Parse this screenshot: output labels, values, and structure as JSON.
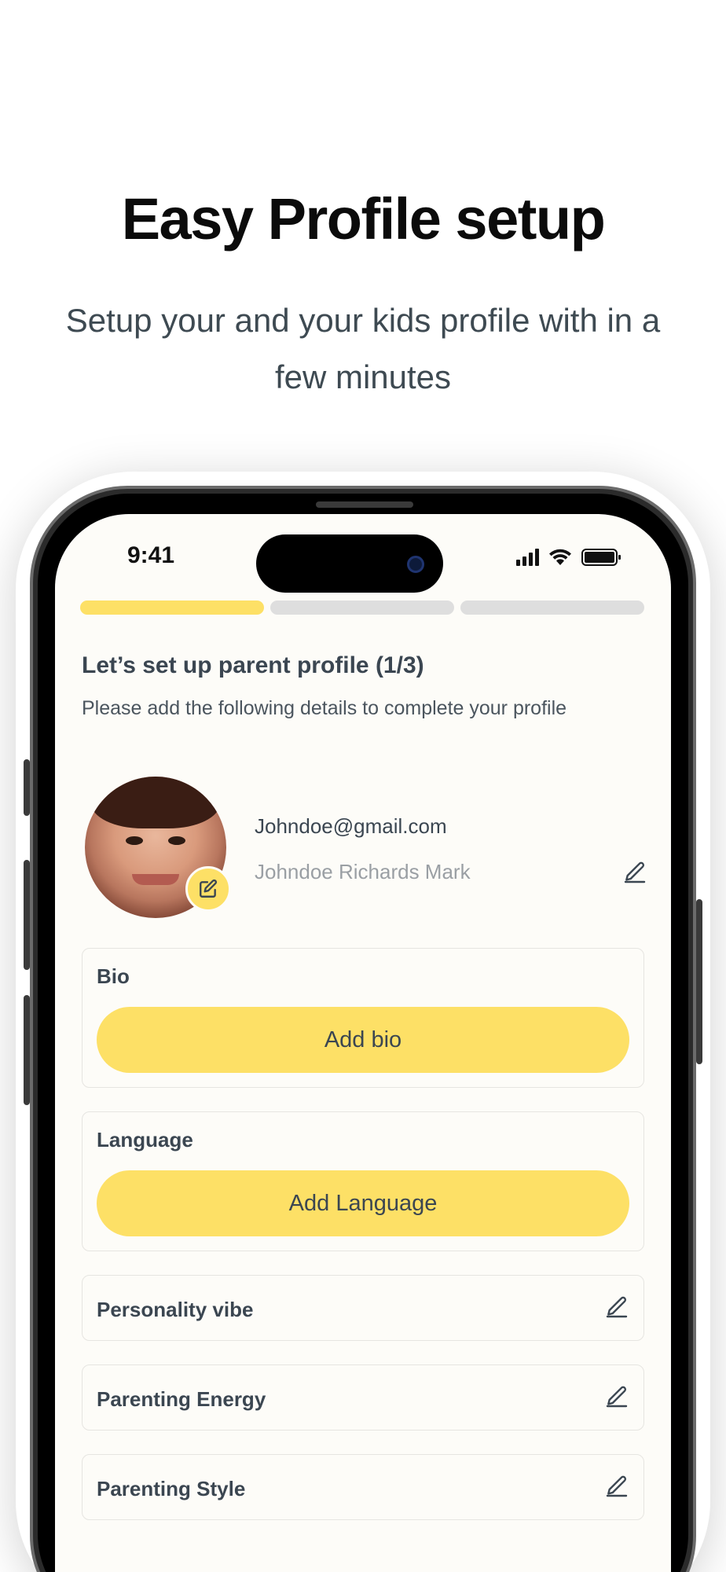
{
  "promo": {
    "title": "Easy Profile setup",
    "subtitle": "Setup your and your kids profile with in a few minutes"
  },
  "status_bar": {
    "time": "9:41"
  },
  "progress": {
    "current_step": 1,
    "total_steps": 3
  },
  "setup": {
    "title": "Let’s set up parent profile (1/3)",
    "description": "Please add the following details to complete your profile"
  },
  "profile": {
    "email": "Johndoe@gmail.com",
    "name": "Johndoe Richards Mark"
  },
  "bio": {
    "label": "Bio",
    "button": "Add bio"
  },
  "language": {
    "label": "Language",
    "button": "Add Language"
  },
  "rows": {
    "personality": "Personality vibe",
    "energy": "Parenting Energy",
    "style": "Parenting Style"
  },
  "colors": {
    "accent": "#fde066",
    "text": "#3b4651",
    "muted": "#9a9fa4",
    "progress_inactive": "#dedede",
    "background": "#fdfcf8"
  },
  "icons": {
    "avatar_edit": "edit-square-icon",
    "row_edit": "pencil-icon",
    "signal": "cellular-signal-icon",
    "wifi": "wifi-icon",
    "battery": "battery-icon"
  }
}
